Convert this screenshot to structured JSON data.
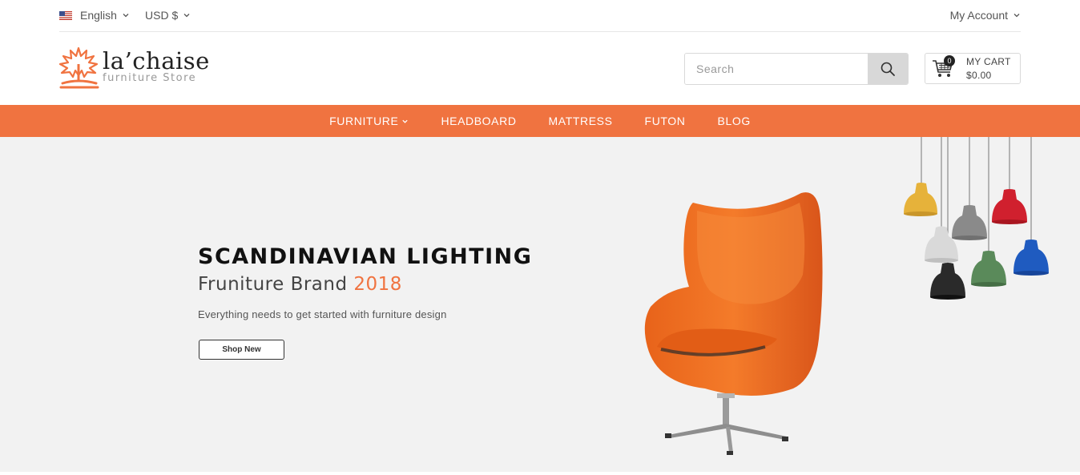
{
  "topbar": {
    "language": "English",
    "currency": "USD $",
    "account": "My Account"
  },
  "logo": {
    "name": "la’chaise",
    "tagline": "furniture Store"
  },
  "search": {
    "placeholder": "Search"
  },
  "cart": {
    "count": "0",
    "label": "MY CART",
    "total": "$0.00"
  },
  "nav": {
    "items": [
      "FURNITURE",
      "HEADBOARD",
      "MATTRESS",
      "FUTON",
      "BLOG"
    ]
  },
  "hero": {
    "title": "SCANDINAVIAN LIGHTING",
    "subtitle_text": "Fruniture Brand ",
    "subtitle_accent": "2018",
    "description": "Everything needs to get started with furniture design",
    "button_label": "Shop New"
  },
  "colors": {
    "accent": "#f07340",
    "hero_bg": "#f2f2f2"
  },
  "icons": [
    "us-flag-icon",
    "chevron-down-icon",
    "logo-icon",
    "search-icon",
    "cart-icon"
  ]
}
